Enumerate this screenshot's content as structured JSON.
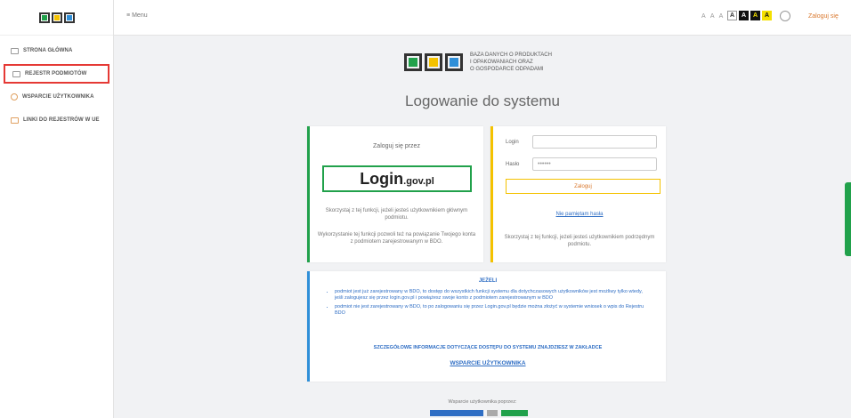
{
  "colors": {
    "accent_red": "#e53935",
    "green": "#21a14b",
    "yellow": "#f4c200",
    "blue": "#2f8fd8",
    "link": "#2f6ec4",
    "orange": "#d9772c"
  },
  "sidebar": {
    "items": [
      {
        "label": "STRONA GŁÓWNA",
        "icon": "home-icon"
      },
      {
        "label": "REJESTR PODMIOTÓW",
        "icon": "register-icon",
        "active": true
      },
      {
        "label": "WSPARCIE UŻYTKOWNIKA",
        "icon": "help-icon"
      },
      {
        "label": "LINKI DO REJESTRÓW W UE",
        "icon": "folder-icon"
      }
    ]
  },
  "topbar": {
    "menu_label": "Menu",
    "font_sizes": "A A A",
    "contrast_options": [
      "A",
      "A",
      "A",
      "A"
    ],
    "login_link": "Zaloguj się"
  },
  "brand": {
    "line1": "BAZA DANYCH O PRODUKTACH",
    "line2": "I OPAKOWANIACH ORAZ",
    "line3": "O GOSPODARCE ODPADAMI"
  },
  "page_title": "Logowanie do systemu",
  "login_gov": {
    "heading": "Zaloguj się przez",
    "button_main": "Login",
    "button_suffix": ".gov.pl",
    "desc1": "Skorzystaj z tej funkcji, jeżeli jesteś użytkownikiem głównym podmiotu.",
    "desc2": "Wykorzystanie tej funkcji pozwoli też na powiązanie Twojego konta z podmiotem zarejestrowanym w BDO."
  },
  "login_form": {
    "login_label": "Login",
    "login_value": "",
    "password_label": "Hasło",
    "password_value": "••••••",
    "submit_label": "Zaloguj",
    "forgot_link": "Nie pamiętam hasła",
    "desc": "Skorzystaj z tej funkcji, jeżeli jesteś użytkownikiem podrzędnym podmiotu."
  },
  "info": {
    "title": "JEŻELI",
    "items": [
      "podmiot jest już zarejestrowany w BDO, to dostęp do wszystkich funkcji systemu dla dotychczasowych użytkowników jest możliwy tylko wtedy, jeśli zalogujesz się przez login.gov.pl i powiążesz swoje konto z podmiotem zarejestrowanym w BDO",
      "podmiot nie jest zarejestrowany w BDO, to po zalogowaniu się przez Login.gov.pl będzie można złożyć w systemie wniosek o wpis do Rejestru BDO"
    ],
    "more": "SZCZEGÓŁOWE INFORMACJE DOTYCZĄCE DOSTĘPU DO SYSTEMU ZNAJDZIESZ W ZAKŁADCE",
    "link": "WSPARCIE UŻYTKOWNIKA"
  },
  "footer": {
    "support": "Wsparcie użytkownika poprzez:"
  }
}
